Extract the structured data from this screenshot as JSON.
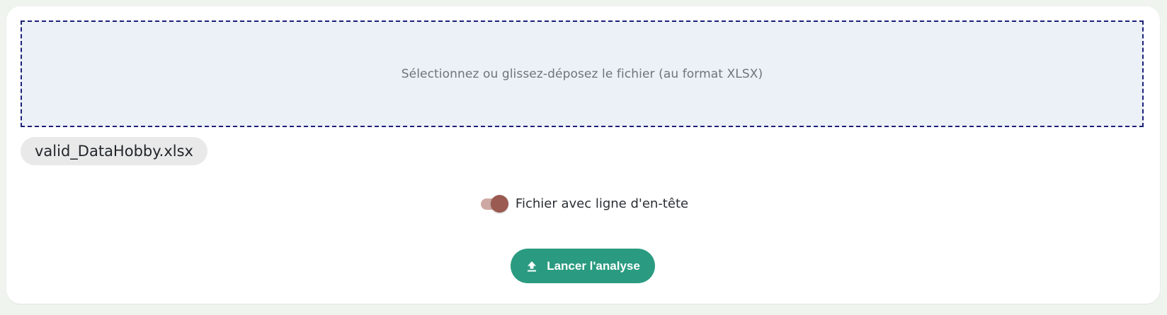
{
  "dropzone": {
    "text": "Sélectionnez ou glissez-déposez le fichier (au format XLSX)"
  },
  "file": {
    "name": "valid_DataHobby.xlsx"
  },
  "header_switch": {
    "label": "Fichier avec ligne d'en-tête",
    "checked": true
  },
  "analyze_button": {
    "label": "Lancer l'analyse",
    "icon": "upload-icon"
  },
  "colors": {
    "background": "#eff5ee",
    "dropzone_fill": "#ecf0f7",
    "dropzone_border": "#1b2178",
    "switch_track": "#cea9a4",
    "switch_thumb": "#9a5a51",
    "button": "#2a9b80"
  }
}
